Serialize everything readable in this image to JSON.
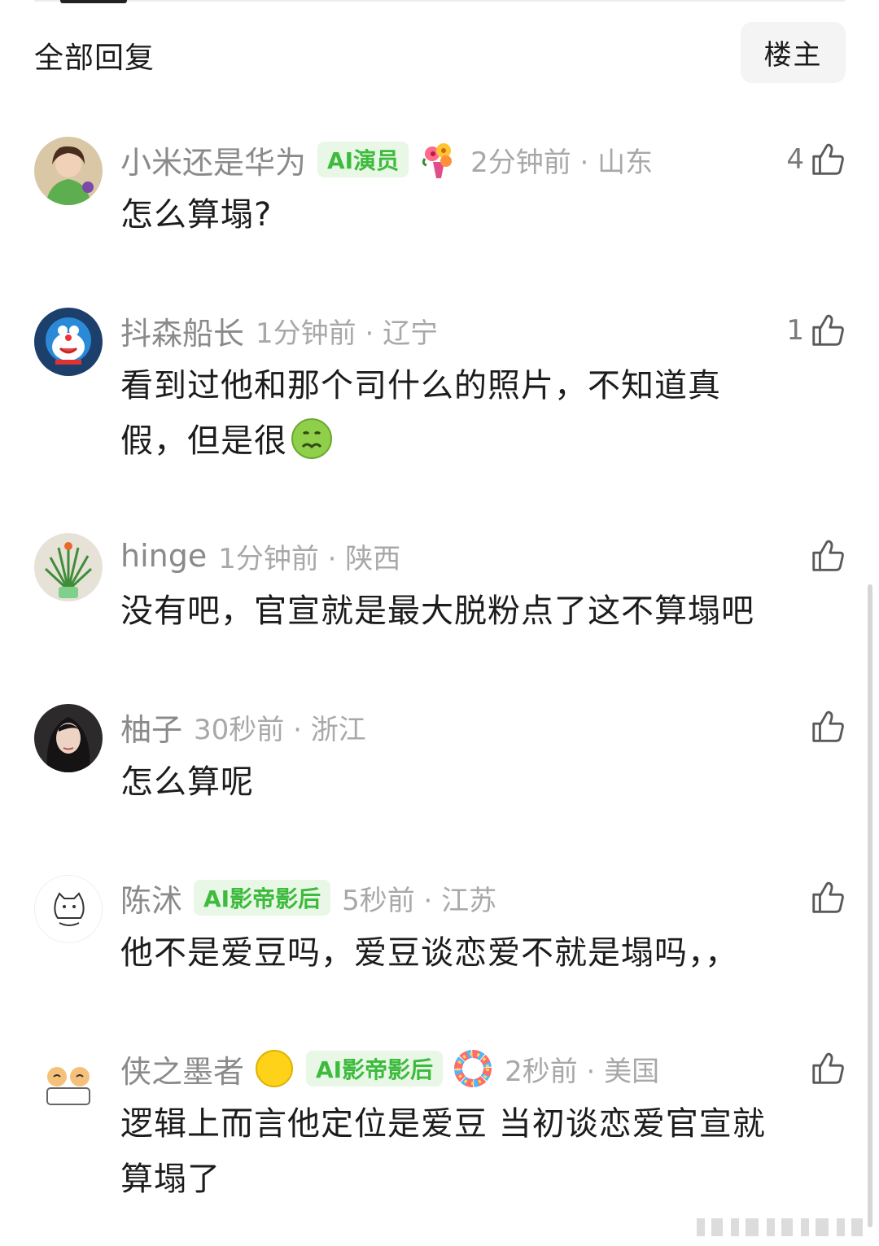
{
  "header": {
    "title": "全部回复",
    "owner_button": "楼主"
  },
  "comments": [
    {
      "username": "小米还是华为",
      "badge": "AI演员",
      "time": "2分钟前 · 山东",
      "likes": "4",
      "text": "怎么算塌?"
    },
    {
      "username": "抖森船长",
      "time": "1分钟前 · 辽宁",
      "likes": "1",
      "text_line1": "看到过他和那个司什么的照片，不知道真",
      "text_line2": "假，但是很"
    },
    {
      "username": "hinge",
      "time": "1分钟前 · 陕西",
      "likes": "",
      "text": "没有吧，官宣就是最大脱粉点了这不算塌吧"
    },
    {
      "username": "柚子",
      "time": "30秒前 · 浙江",
      "likes": "",
      "text": "怎么算呢"
    },
    {
      "username": "陈沭",
      "badge": "AI影帝影后",
      "time": "5秒前 · 江苏",
      "likes": "",
      "text": "他不是爱豆吗，爱豆谈恋爱不就是塌吗，，"
    },
    {
      "username": "侠之墨者",
      "badge": "AI影帝影后",
      "time": "2秒前 · 美国",
      "likes": "",
      "text_line1": "逻辑上而言他定位是爱豆 当初谈恋爱官宣就",
      "text_line2": "算塌了"
    }
  ],
  "colors": {
    "badge_green": "#3dbb3d",
    "badge_bg": "#e9f7e6",
    "meta_gray": "#a8a8a8"
  }
}
